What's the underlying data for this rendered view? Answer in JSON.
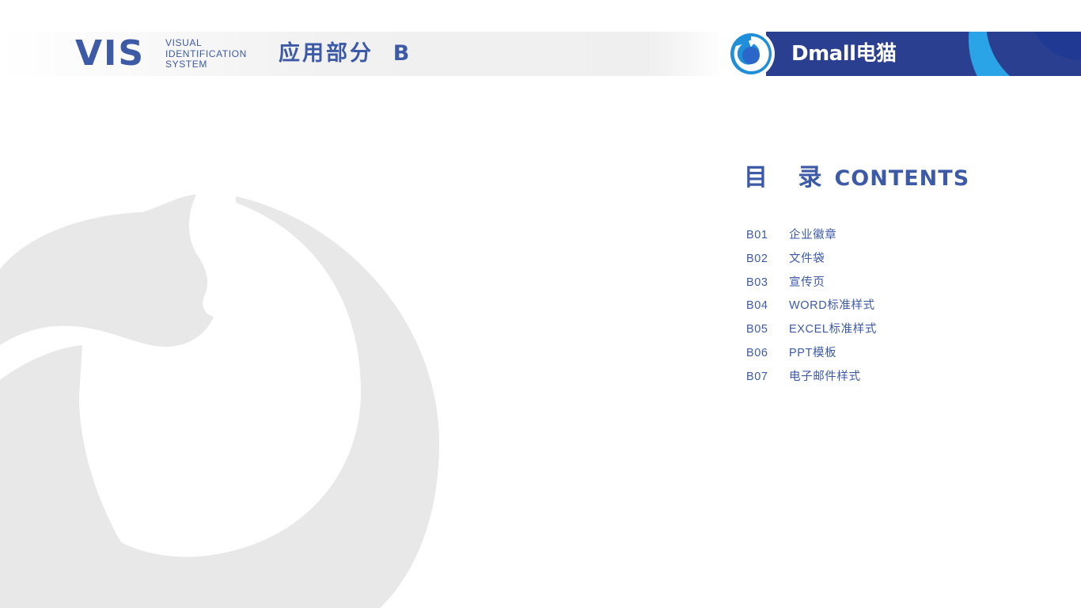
{
  "header": {
    "logo": "VIS",
    "subtitle_lines": [
      "VISUAL",
      "IDENTIFICATION",
      "SYSTEM"
    ],
    "section_title": "应用部分  B",
    "brand_name": "Dmall电猫"
  },
  "contents": {
    "title_cn": "目 录",
    "title_en": "CONTENTS",
    "items": [
      {
        "code": "B01",
        "label": "企业徽章"
      },
      {
        "code": "B02",
        "label": "文件袋"
      },
      {
        "code": "B03",
        "label": "宣传页"
      },
      {
        "code": "B04",
        "label": "WORD标准样式"
      },
      {
        "code": "B05",
        "label": "EXCEL标准样式"
      },
      {
        "code": "B06",
        "label": "PPT模板"
      },
      {
        "code": "B07",
        "label": "电子邮件样式"
      }
    ]
  },
  "colors": {
    "brand_blue": "#3d5aa7",
    "band_dark": "#2a3f8f",
    "band_light": "#2aa4e6",
    "watermark_gray": "#e8e8e8"
  }
}
